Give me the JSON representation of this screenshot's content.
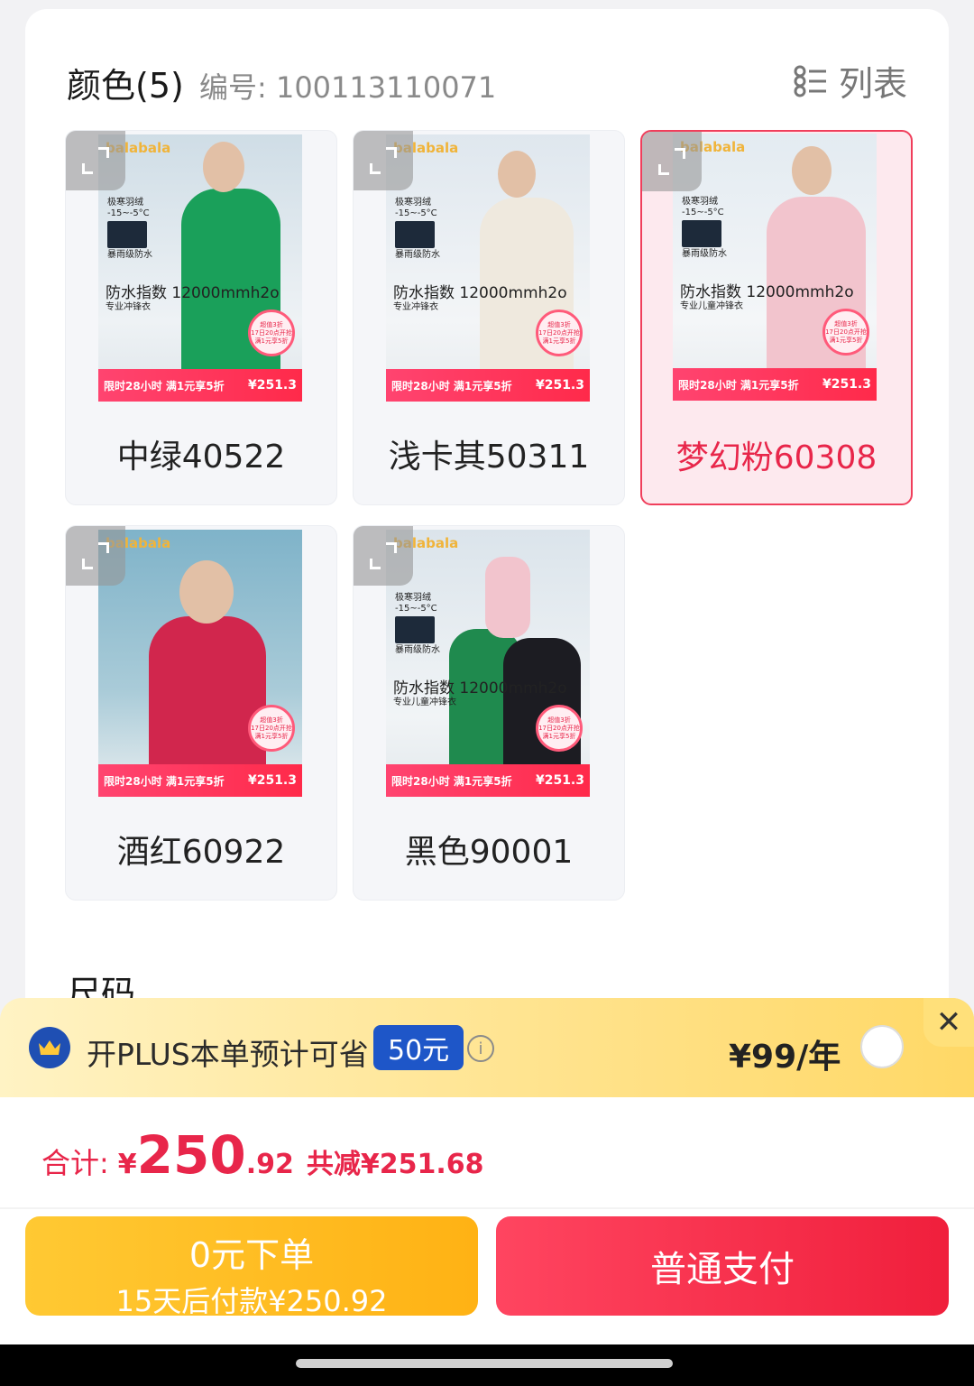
{
  "header": {
    "title": "颜色(5)",
    "code": "编号: 100113110071",
    "list_label": "列表"
  },
  "swatches": [
    {
      "label": "中绿40522",
      "selected": false,
      "brand": "balabala",
      "feat": "极寒羽绒 -15~-5°C",
      "feat2": "暴雨级防水",
      "water": "防水指数 12000mmh2o",
      "water_sub": "专业冲锋衣",
      "sticker1": "超值3折",
      "sticker2": "17日20点开抢",
      "sticker3": "满1元享5折",
      "promo": "限时28小时 满1元享5折",
      "price": "¥251.3",
      "colors": {
        "bg": "#cfdde6",
        "coat": "#1aa05a"
      }
    },
    {
      "label": "浅卡其50311",
      "selected": false,
      "brand": "balabala",
      "feat": "极寒羽绒 -15~-5°C",
      "feat2": "暴雨级防水",
      "water": "防水指数 12000mmh2o",
      "water_sub": "专业冲锋衣",
      "sticker1": "超值3折",
      "sticker2": "17日20点开抢",
      "sticker3": "满1元享5折",
      "promo": "限时28小时 满1元享5折",
      "price": "¥251.3",
      "colors": {
        "bg": "#dfe7ee",
        "coat": "#efe9de"
      }
    },
    {
      "label": "梦幻粉60308",
      "selected": true,
      "brand": "balabala",
      "feat": "极寒羽绒 -15~-5°C",
      "feat2": "暴雨级防水",
      "water": "防水指数 12000mmh2o",
      "water_sub": "专业儿童冲锋衣",
      "sticker1": "超值3折",
      "sticker2": "17日20点开抢",
      "sticker3": "满1元享5折",
      "promo": "限时28小时 满1元享5折",
      "price": "¥251.3",
      "colors": {
        "bg": "#e3ebf1",
        "coat": "#f2c4cd"
      }
    },
    {
      "label": "酒红60922",
      "selected": false,
      "brand": "balabala",
      "feat": "",
      "feat2": "",
      "water": "",
      "water_sub": "",
      "sticker1": "超值3折",
      "sticker2": "17日20点开抢",
      "sticker3": "满1元享5折",
      "promo": "限时28小时 满1元享5折",
      "price": "¥251.3",
      "colors": {
        "bg": "#7fb3c9",
        "coat": "#d1264d"
      }
    },
    {
      "label": "黑色90001",
      "selected": false,
      "brand": "balabala",
      "feat": "极寒羽绒 -15~-5°C",
      "feat2": "暴雨级防水",
      "water": "防水指数 12000mmh2o",
      "water_sub": "专业儿童冲锋衣",
      "sticker1": "超值3折",
      "sticker2": "17日20点开抢",
      "sticker3": "满1元享5折",
      "promo": "限时28小时 满1元享5折",
      "price": "¥251.3",
      "colors": {
        "bg": "#dbe4eb",
        "coat": "#1f8a4e"
      }
    }
  ],
  "size_label": "尺码",
  "plus_banner": {
    "text": "开PLUS本单预计可省",
    "badge": "50元",
    "price": "¥99/年",
    "close": "✕"
  },
  "summary": {
    "label": "合计:",
    "yen": "¥",
    "amount_int": "250",
    "amount_dec": ".92",
    "saved": "共减¥251.68"
  },
  "buttons": {
    "zero_line1": "0元下单",
    "zero_line2": "15天后付款¥250.92",
    "pay": "普通支付"
  }
}
